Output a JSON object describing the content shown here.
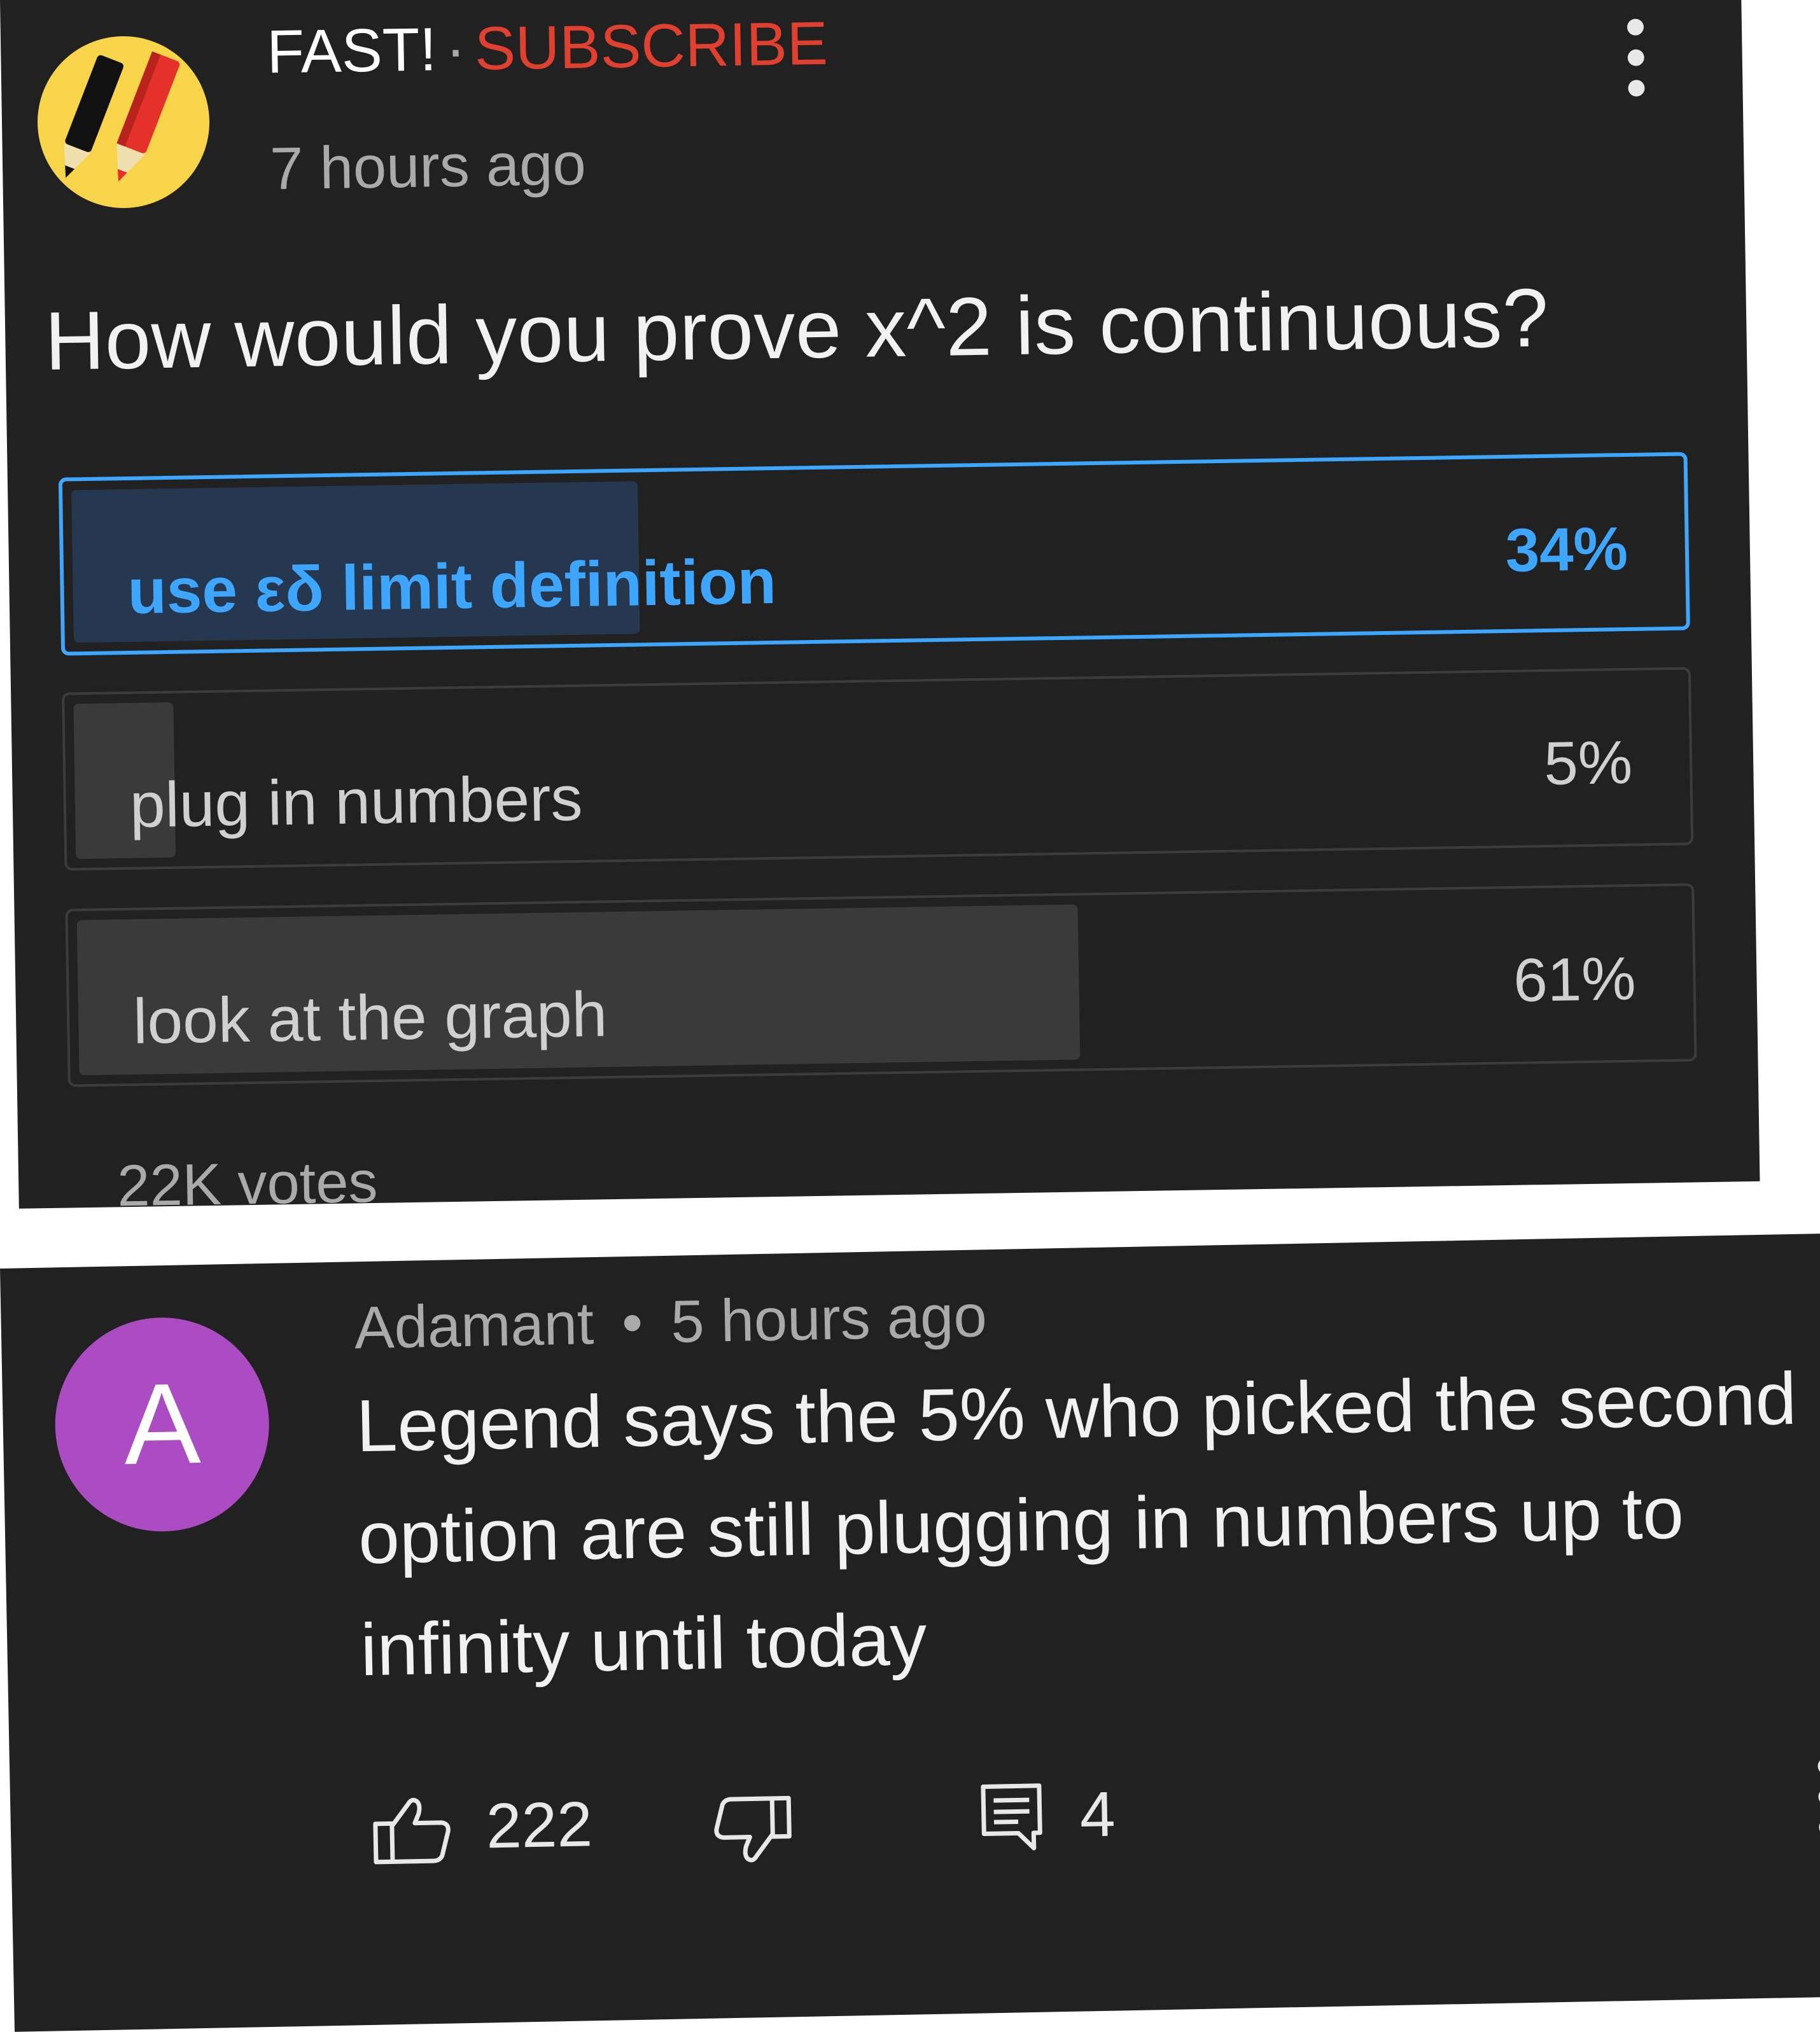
{
  "post": {
    "channel_name": "FAST!",
    "separator": "·",
    "subscribe_label": "SUBSCRIBE",
    "time": "7 hours ago",
    "question": "How would you prove x^2 is continuous?",
    "poll": {
      "options": [
        {
          "label": "use εδ limit definition",
          "percent_label": "34%",
          "fraction": 0.34,
          "selected": true
        },
        {
          "label": "plug in numbers",
          "percent_label": "5%",
          "fraction": 0.05,
          "selected": false
        },
        {
          "label": "look at the graph",
          "percent_label": "61%",
          "fraction": 0.61,
          "selected": false
        }
      ],
      "votes": "22K votes"
    },
    "colors": {
      "accent": "#3ea6ff",
      "subscribe": "#e0402f",
      "background": "#212121"
    },
    "icons": {
      "avatar": "pencils-logo",
      "menu": "more-vert-icon"
    }
  },
  "comment": {
    "avatar_letter": "A",
    "author": "Adamant",
    "separator": "•",
    "time": "5 hours ago",
    "text": "Legend says the 5% who picked the second option are still plugging in numbers up to infinity until today",
    "like_count": "222",
    "reply_count": "4",
    "colors": {
      "avatar": "#ac4cc2"
    },
    "icons": {
      "like": "thumbs-up-icon",
      "dislike": "thumbs-down-icon",
      "reply": "reply-icon",
      "menu": "more-vert-icon"
    }
  }
}
